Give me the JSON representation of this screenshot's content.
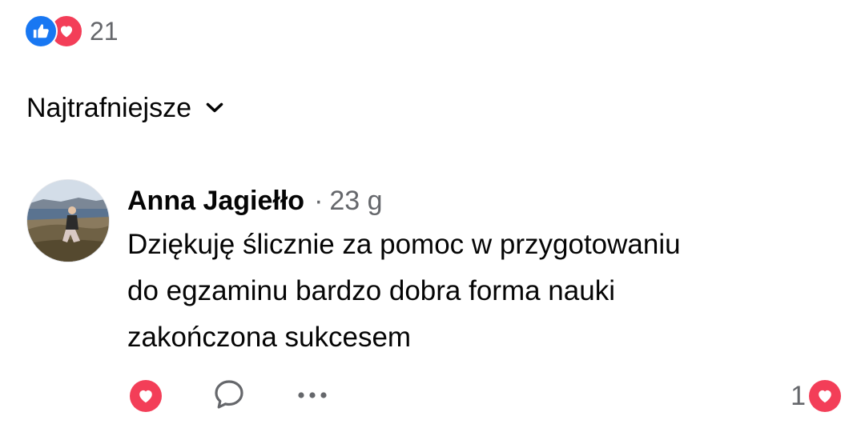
{
  "reactions_summary": {
    "icons": [
      "like-icon",
      "love-icon"
    ],
    "count": "21"
  },
  "sort": {
    "label": "Najtrafniejsze",
    "icon": "chevron-down-icon"
  },
  "comment": {
    "author": "Anna Jagiełło",
    "separator": "·",
    "time": "23 g",
    "text_lines": [
      "Dziękuję ślicznie za pomoc w przygotowaniu",
      "do egzaminu bardzo dobra forma nauki",
      "zakończona sukcesem"
    ],
    "actions": {
      "react_icon": "love-icon",
      "reply_icon": "comment-bubble-icon",
      "more_icon": "more-options-icon"
    },
    "reaction_count": "1",
    "reaction_count_icon": "love-icon"
  },
  "colors": {
    "like_blue": "#1877f2",
    "love_red": "#f33e58",
    "secondary_text": "#65676b",
    "primary_text": "#050505"
  }
}
